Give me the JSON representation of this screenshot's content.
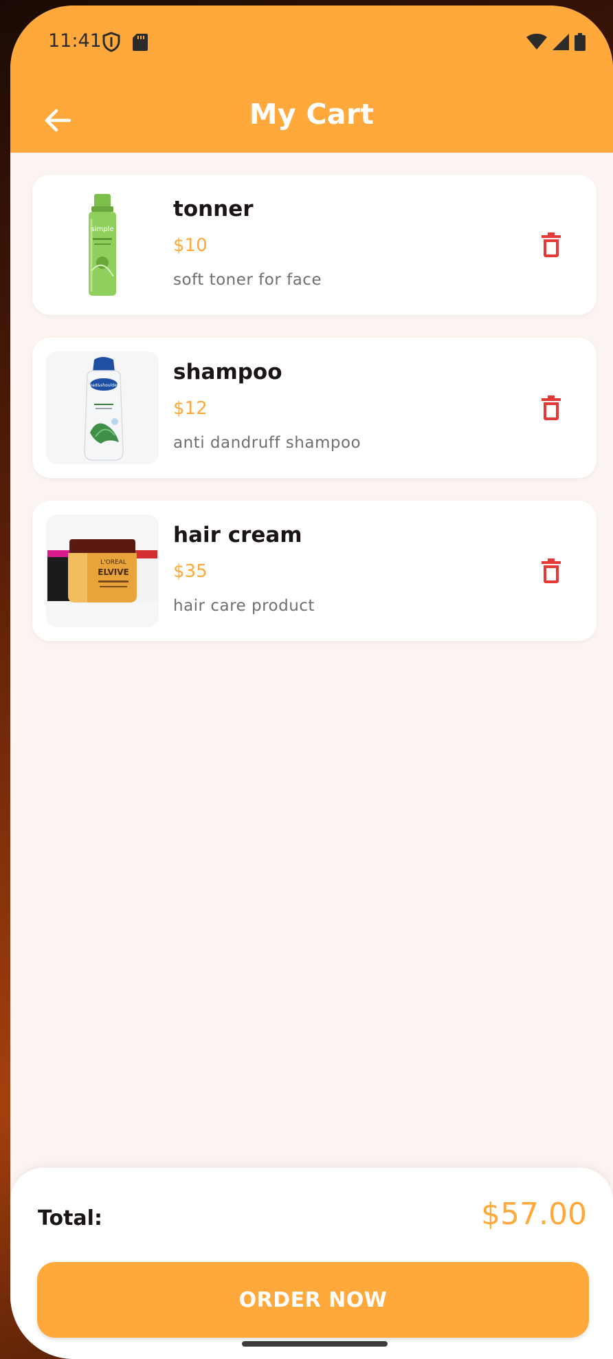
{
  "status_bar": {
    "time": "11:41",
    "icons": [
      "shield-icon",
      "sd-card-icon",
      "wifi-icon",
      "signal-icon",
      "battery-icon"
    ]
  },
  "appbar": {
    "title": "My Cart",
    "back_icon": "arrow-left-icon"
  },
  "cart": {
    "items": [
      {
        "name": "tonner",
        "price": "$10",
        "description": "soft toner for face",
        "image": "toner-bottle-image"
      },
      {
        "name": "shampoo",
        "price": "$12",
        "description": "anti dandruff shampoo",
        "image": "shampoo-bottle-image"
      },
      {
        "name": "hair cream",
        "price": "$35",
        "description": "hair care product",
        "image": "hair-cream-jar-image"
      }
    ]
  },
  "summary": {
    "total_label": "Total:",
    "total_value": "$57.00",
    "order_button": "ORDER NOW"
  },
  "product_labels": {
    "toner_brand": "simple",
    "shampoo_brand": "head&shoulders",
    "cream_brand": "L'OREAL",
    "cream_line": "ELVIVE"
  },
  "colors": {
    "accent": "#FFA83C",
    "background": "#FCF4F1",
    "delete": "#E53935",
    "text_dark": "#1b1414",
    "text_muted": "#6f6f6f"
  }
}
